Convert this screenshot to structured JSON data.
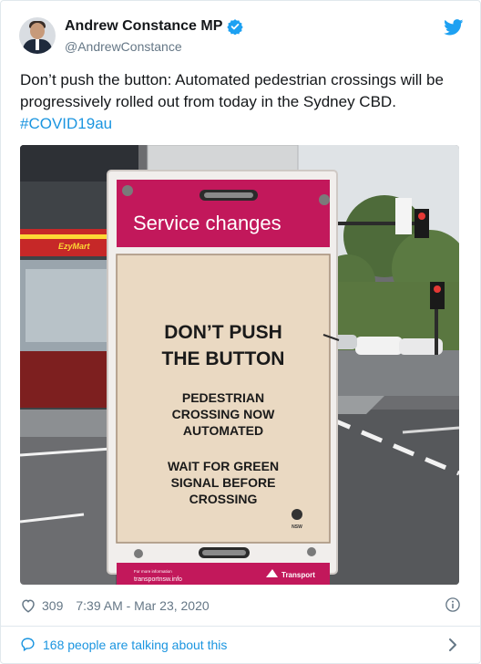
{
  "author": {
    "name": "Andrew Constance MP",
    "handle": "@AndrewConstance"
  },
  "tweet": {
    "text": "Don’t push the button: Automated pedestrian crossings will be progressively rolled out from today in the Sydney CBD.",
    "hashtag": "#COVID19au"
  },
  "photo": {
    "store_sign": "EzyMart",
    "header": "Service changes",
    "headline_line1": "DON’T PUSH",
    "headline_line2": "THE BUTTON",
    "notice_line1": "PEDESTRIAN",
    "notice_line2": "CROSSING NOW",
    "notice_line3": "AUTOMATED",
    "instruction_line1": "WAIT FOR GREEN",
    "instruction_line2": "SIGNAL BEFORE",
    "instruction_line3": "CROSSING",
    "nsw_label": "NSW",
    "footer_small": "For more information",
    "footer_url": "transportnsw.info",
    "footer_brand": "Transport"
  },
  "meta": {
    "likes": "309",
    "timestamp": "7:39 AM - Mar 23, 2020"
  },
  "conversation": {
    "label": "168 people are talking about this"
  },
  "colors": {
    "link": "#1b95e0",
    "sign_magenta": "#c2185b",
    "text_secondary": "#657786"
  },
  "icons": [
    "verified-badge-icon",
    "twitter-bird-icon",
    "heart-icon",
    "info-icon",
    "speech-bubble-icon",
    "chevron-right-icon"
  ]
}
